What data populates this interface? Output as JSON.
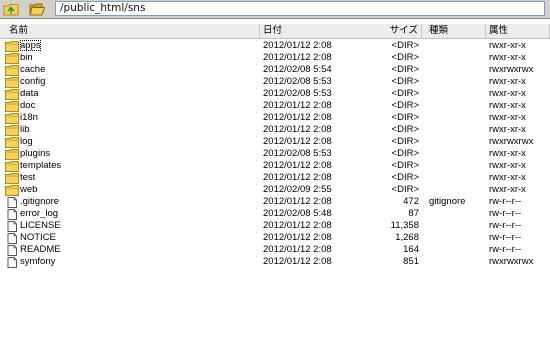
{
  "toolbar": {
    "up_icon": "folder-up-icon",
    "open_icon": "folder-open-icon",
    "path": "/public_html/sns"
  },
  "columns": {
    "name": "名前",
    "date": "日付",
    "size": "サイズ",
    "type": "種類",
    "attr": "属性"
  },
  "files": [
    {
      "name": "apps",
      "date": "2012/01/12  2:08",
      "size": "<DIR>",
      "type": "",
      "attr": "rwxr-xr-x",
      "kind": "folder"
    },
    {
      "name": "bin",
      "date": "2012/01/12  2:08",
      "size": "<DIR>",
      "type": "",
      "attr": "rwxr-xr-x",
      "kind": "folder"
    },
    {
      "name": "cache",
      "date": "2012/02/08  5:54",
      "size": "<DIR>",
      "type": "",
      "attr": "rwxrwxrwx",
      "kind": "folder"
    },
    {
      "name": "config",
      "date": "2012/02/08  5:53",
      "size": "<DIR>",
      "type": "",
      "attr": "rwxr-xr-x",
      "kind": "folder"
    },
    {
      "name": "data",
      "date": "2012/02/08  5:53",
      "size": "<DIR>",
      "type": "",
      "attr": "rwxr-xr-x",
      "kind": "folder"
    },
    {
      "name": "doc",
      "date": "2012/01/12  2:08",
      "size": "<DIR>",
      "type": "",
      "attr": "rwxr-xr-x",
      "kind": "folder"
    },
    {
      "name": "i18n",
      "date": "2012/01/12  2:08",
      "size": "<DIR>",
      "type": "",
      "attr": "rwxr-xr-x",
      "kind": "folder"
    },
    {
      "name": "lib",
      "date": "2012/01/12  2:08",
      "size": "<DIR>",
      "type": "",
      "attr": "rwxr-xr-x",
      "kind": "folder"
    },
    {
      "name": "log",
      "date": "2012/01/12  2:08",
      "size": "<DIR>",
      "type": "",
      "attr": "rwxrwxrwx",
      "kind": "folder"
    },
    {
      "name": "plugins",
      "date": "2012/02/08  5:53",
      "size": "<DIR>",
      "type": "",
      "attr": "rwxr-xr-x",
      "kind": "folder"
    },
    {
      "name": "templates",
      "date": "2012/01/12  2:08",
      "size": "<DIR>",
      "type": "",
      "attr": "rwxr-xr-x",
      "kind": "folder"
    },
    {
      "name": "test",
      "date": "2012/01/12  2:08",
      "size": "<DIR>",
      "type": "",
      "attr": "rwxr-xr-x",
      "kind": "folder"
    },
    {
      "name": "web",
      "date": "2012/02/09  2:55",
      "size": "<DIR>",
      "type": "",
      "attr": "rwxr-xr-x",
      "kind": "folder"
    },
    {
      "name": ".gitignore",
      "date": "2012/01/12  2:08",
      "size": "472",
      "type": "gitignore",
      "attr": "rw-r--r--",
      "kind": "file"
    },
    {
      "name": "error_log",
      "date": "2012/02/08  5:48",
      "size": "87",
      "type": "",
      "attr": "rw-r--r--",
      "kind": "file"
    },
    {
      "name": "LICENSE",
      "date": "2012/01/12  2:08",
      "size": "11,358",
      "type": "",
      "attr": "rw-r--r--",
      "kind": "file"
    },
    {
      "name": "NOTICE",
      "date": "2012/01/12  2:08",
      "size": "1,268",
      "type": "",
      "attr": "rw-r--r--",
      "kind": "file"
    },
    {
      "name": "README",
      "date": "2012/01/12  2:08",
      "size": "164",
      "type": "",
      "attr": "rw-r--r--",
      "kind": "file"
    },
    {
      "name": "symfony",
      "date": "2012/01/12  2:08",
      "size": "851",
      "type": "",
      "attr": "rwxrwxrwx",
      "kind": "file"
    }
  ],
  "colors": {
    "folder": "#f3d15a",
    "folder_edge": "#b08a1a",
    "up_arrow": "#2f8f2f"
  }
}
